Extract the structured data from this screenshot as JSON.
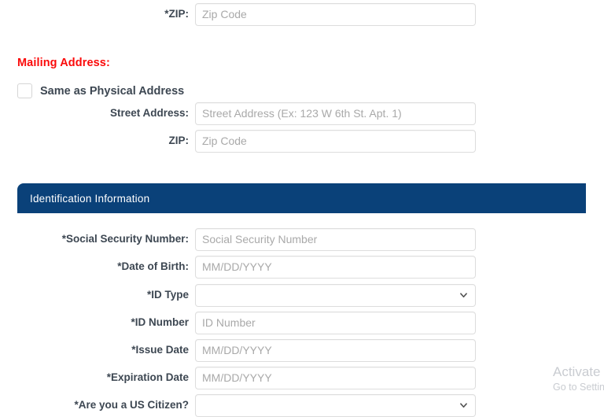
{
  "physical_address": {
    "zip": {
      "label": "*ZIP:",
      "placeholder": "Zip Code",
      "value": ""
    }
  },
  "mailing_address": {
    "heading": "Mailing Address:",
    "same_as_physical": {
      "label": "Same as Physical Address",
      "checked": false
    },
    "street": {
      "label": "Street Address:",
      "placeholder": "Street Address (Ex: 123 W 6th St. Apt. 1)",
      "value": ""
    },
    "zip": {
      "label": "ZIP:",
      "placeholder": "Zip Code",
      "value": ""
    }
  },
  "identification": {
    "panel_title": "Identification Information",
    "ssn": {
      "label": "*Social Security Number:",
      "placeholder": "Social Security Number",
      "value": ""
    },
    "dob": {
      "label": "*Date of Birth:",
      "placeholder": "MM/DD/YYYY",
      "value": ""
    },
    "id_type": {
      "label": "*ID Type",
      "selected": "",
      "options": []
    },
    "id_number": {
      "label": "*ID Number",
      "placeholder": "ID Number",
      "value": ""
    },
    "issue_date": {
      "label": "*Issue Date",
      "placeholder": "MM/DD/YYYY",
      "value": ""
    },
    "expiration_date": {
      "label": "*Expiration Date",
      "placeholder": "MM/DD/YYYY",
      "value": ""
    },
    "us_citizen": {
      "label": "*Are you a US Citizen?",
      "selected": "",
      "options": []
    }
  },
  "watermark": {
    "title": "Activate W",
    "subtitle": "Go to Settin"
  },
  "colors": {
    "panel_header_bg": "#0a4179",
    "required_heading": "#fb0a0a",
    "label_text": "#3d4752",
    "placeholder_text": "#a9a9a9",
    "input_border": "#dddddd",
    "watermark_text": "#c9ccd1"
  }
}
